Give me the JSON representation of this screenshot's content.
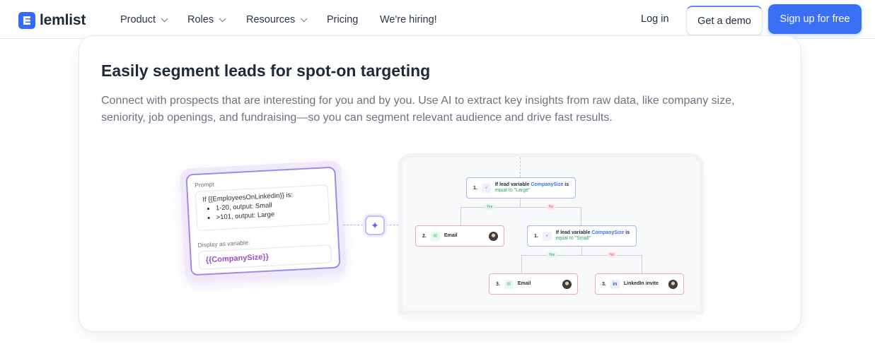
{
  "nav": {
    "logo_text": "lemlist",
    "items": [
      {
        "label": "Product",
        "dropdown": true
      },
      {
        "label": "Roles",
        "dropdown": true
      },
      {
        "label": "Resources",
        "dropdown": true
      },
      {
        "label": "Pricing",
        "dropdown": false
      },
      {
        "label": "We're hiring!",
        "dropdown": false
      }
    ],
    "login_label": "Log in",
    "demo_label": "Get a demo",
    "signup_label": "Sign up for free",
    "accent_color": "#3b6ff6"
  },
  "feature": {
    "title": "Easily segment leads for spot-on targeting",
    "description": "Connect with prospects that are interesting for you and by you. Use AI to extract key insights from raw data, like company size, seniority, job openings, and fundraising—so you can segment relevant audience and drive fast results."
  },
  "prompt_panel": {
    "prompt_label": "Prompt",
    "prompt_line": "If {{EmployeesOnLinkedin}} is:",
    "prompt_bullets": [
      "1-20, output: Small",
      ">101, output: Large"
    ],
    "display_label": "Display as variable:",
    "variable": "{{CompanySize}}",
    "ai_icon": "sparkle-icon"
  },
  "flow": {
    "node1": {
      "num": "1.",
      "text_a": "If lead variable ",
      "var": "CompanySize",
      "text_b": " is",
      "cond": "equal to \"Large\""
    },
    "yes_label": "Yes",
    "no_label": "No",
    "node2": {
      "num": "2.",
      "label": "Email"
    },
    "node3": {
      "num": "1.",
      "text_a": "If lead variable ",
      "var": "CompanySize",
      "text_b": " is",
      "cond": "equal to \"Small\""
    },
    "node4": {
      "num": "3.",
      "label": "Email"
    },
    "node5": {
      "num": "3.",
      "label": "LinkedIn invite"
    }
  }
}
